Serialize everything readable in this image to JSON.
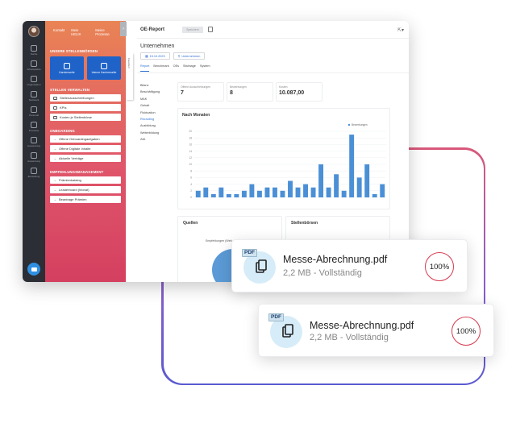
{
  "rail": {
    "items": [
      "Suche",
      "Arbeitsplätze",
      "Organisation",
      "Netzwerk",
      "Personal",
      "Prozesse",
      "Auswertung",
      "Auswertung",
      "Einstellung"
    ]
  },
  "nav": {
    "top_links": [
      "Kontakt",
      "Mein HELIX",
      "Meine Prozesse"
    ],
    "section_titles": [
      "UNSERE STELLENBÖRSEN",
      "STELLEN VERWALTEN",
      "ONBOARDING",
      "EMPFEHLUNGSMANAGEMENT"
    ],
    "tiles": [
      "Karriereseite",
      "Interne Karriereseite"
    ],
    "stellen": [
      "Stellenausschreibungen",
      "KPIs",
      "Kosten je Stellenbörse"
    ],
    "onboarding": [
      "Offene Onboardingaufgaben",
      "Offene Digitale Inhalte",
      "Aktuelle Verträge"
    ],
    "empfehlung": [
      "Prämienkatalog",
      "Leaderboard (Monat)",
      "Beantrage Prämien"
    ],
    "side_tab": "Favoriten"
  },
  "main": {
    "title": "OE-Report",
    "header_button": "Speichern",
    "company": "Unternehmen",
    "date_chip": "15.10.2023",
    "org_chip": "Unternehmen",
    "tabs": [
      "Report",
      "Benchmark",
      "OEs",
      "Stichtage",
      "System"
    ],
    "active_tab": "Report",
    "side_items": [
      "Bilanz",
      "Beschäftigung",
      "MAK",
      "Gehalt",
      "Fluktuation",
      "Recruiting",
      "Ausbildung",
      "Weiterbildung",
      "Zeit"
    ],
    "active_side": "Recruiting",
    "kpis": [
      {
        "label": "Offene Ausschreibungen",
        "value": "7"
      },
      {
        "label": "Bewerbungen",
        "value": "8"
      },
      {
        "label": "Kosten",
        "value": "10.087,00"
      }
    ],
    "chart_card_title": "Nach Monaten",
    "quellen_title": "Quellen",
    "quellen_label": "Empfehlungen (Weit...",
    "stellenboersen_title": "Stellenbörsen"
  },
  "chart_data": {
    "type": "bar",
    "title": "Nach Monaten",
    "legend": [
      "Bewerbungen"
    ],
    "legend_position": "top-right",
    "ylim": [
      0,
      20
    ],
    "yticks": [
      0,
      2,
      4,
      6,
      8,
      10,
      12,
      14,
      16,
      18,
      20
    ],
    "grid": true,
    "color": "#4b8fd6",
    "values": [
      2,
      3,
      1,
      3,
      1,
      1,
      2,
      4,
      2,
      3,
      3,
      2,
      5,
      3,
      4,
      3,
      10,
      3,
      7,
      2,
      19,
      6,
      10,
      1,
      4
    ]
  },
  "notifications": [
    {
      "title": "Messe-Abrechnung.pdf",
      "subtitle": "2,2 MB - Vollständig",
      "badge": "PDF",
      "progress_label": "100%",
      "progress": 1.0
    },
    {
      "title": "Messe-Abrechnung.pdf",
      "subtitle": "2,2 MB - Vollständig",
      "badge": "PDF",
      "progress_label": "100%",
      "progress": 1.0
    }
  ]
}
